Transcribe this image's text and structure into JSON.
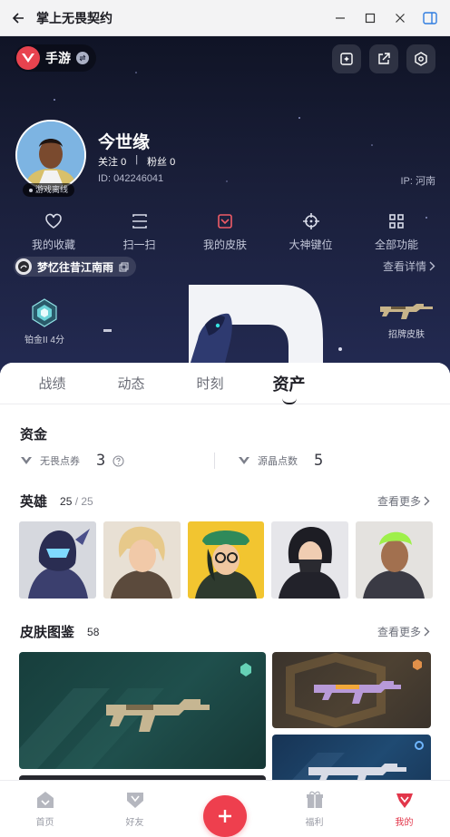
{
  "window": {
    "title": "掌上无畏契约"
  },
  "hero": {
    "brand_text": "手游",
    "user": {
      "name": "今世缘",
      "follow_label": "关注",
      "follow_count": "0",
      "fans_label": "粉丝",
      "fans_count": "0",
      "id_text": "ID:  042246041",
      "ip_text": "IP:  河南",
      "status": "游戏离线"
    },
    "quick_nav": [
      {
        "label": "我的收藏",
        "icon": "heart-icon"
      },
      {
        "label": "扫一扫",
        "icon": "scan-icon"
      },
      {
        "label": "我的皮肤",
        "icon": "skin-icon"
      },
      {
        "label": "大神键位",
        "icon": "crosshair-icon"
      },
      {
        "label": "全部功能",
        "icon": "grid-icon"
      }
    ],
    "team_name": "梦忆往昔江南雨",
    "view_detail": "查看详情",
    "rank_label": "铂金II 4分",
    "skin_label": "招牌皮肤"
  },
  "tabs": [
    {
      "label": "战绩",
      "active": false
    },
    {
      "label": "动态",
      "active": false
    },
    {
      "label": "时刻",
      "active": false
    },
    {
      "label": "资产",
      "active": true
    }
  ],
  "funds": {
    "title": "资金",
    "items": [
      {
        "label": "无畏点券",
        "value": "3"
      },
      {
        "label": "源晶点数",
        "value": "5"
      }
    ]
  },
  "heroes": {
    "title": "英雄",
    "owned": "25",
    "total": "/ 25",
    "more": "查看更多"
  },
  "skins": {
    "title": "皮肤图鉴",
    "count": "58",
    "more": "查看更多"
  },
  "bottom_nav": [
    {
      "label": "首页",
      "icon": "home-icon",
      "active": false
    },
    {
      "label": "好友",
      "icon": "friends-icon",
      "active": false
    },
    {
      "label": "",
      "icon": "plus-icon",
      "active": false
    },
    {
      "label": "福利",
      "icon": "gift-icon",
      "active": false
    },
    {
      "label": "我的",
      "icon": "profile-icon",
      "active": true
    }
  ],
  "colors": {
    "accent": "#ee3f4e",
    "hero_bg": "#1a1f3a",
    "skin_green": "#1f4f4c",
    "skin_brown": "#4d4132",
    "skin_blue": "#1f4a72"
  }
}
